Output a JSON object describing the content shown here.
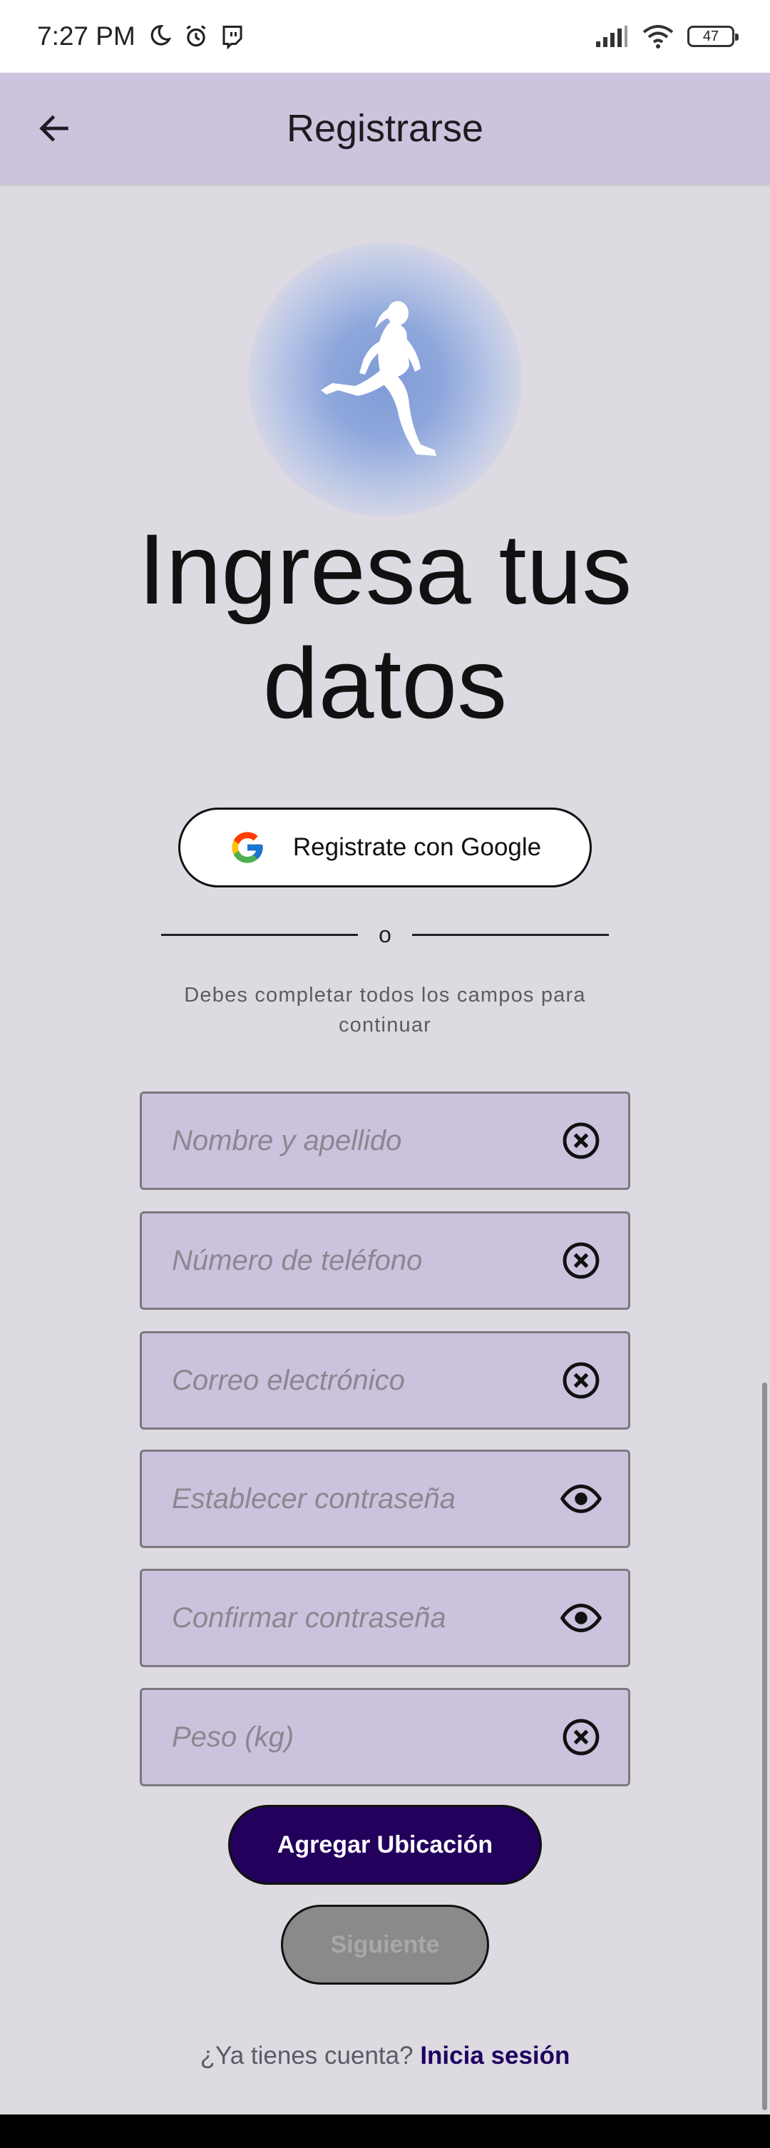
{
  "status_bar": {
    "time": "7:27 PM",
    "battery": "47",
    "left_icons": [
      "moon-icon",
      "alarm-icon",
      "twitch-icon"
    ],
    "right_icons": [
      "signal-icon",
      "wifi-icon",
      "battery-icon"
    ]
  },
  "app_bar": {
    "title": "Registrarse",
    "back_icon": "arrow-back-icon"
  },
  "logo": {
    "icon": "runner-icon",
    "glow_color": "#7f9ad6"
  },
  "heading": {
    "line1": "Ingresa tus",
    "line2": "datos"
  },
  "google_button": {
    "label": "Registrate con Google",
    "icon": "google-icon"
  },
  "divider": {
    "text": "o"
  },
  "instruction": "Debes completar todos los campos para continuar",
  "fields": [
    {
      "placeholder": "Nombre y apellido",
      "trailing_icon": "clear-icon"
    },
    {
      "placeholder": "Número de teléfono",
      "trailing_icon": "clear-icon"
    },
    {
      "placeholder": "Correo electrónico",
      "trailing_icon": "clear-icon"
    },
    {
      "placeholder": "Establecer contraseña",
      "trailing_icon": "eye-icon"
    },
    {
      "placeholder": "Confirmar contraseña",
      "trailing_icon": "eye-icon"
    },
    {
      "placeholder": "Peso (kg)",
      "trailing_icon": "clear-icon"
    }
  ],
  "buttons": {
    "add_location": "Agregar Ubicación",
    "next": "Siguiente"
  },
  "login_prompt": {
    "text": "¿Ya tienes cuenta?",
    "link": "Inicia sesión"
  },
  "colors": {
    "app_bar": "#cdc3dd",
    "background": "#dddae2",
    "field_fill": "#cbc3dd",
    "primary_button": "#22005c",
    "disabled_button": "#8a8a8a",
    "link": "#1f0060"
  }
}
